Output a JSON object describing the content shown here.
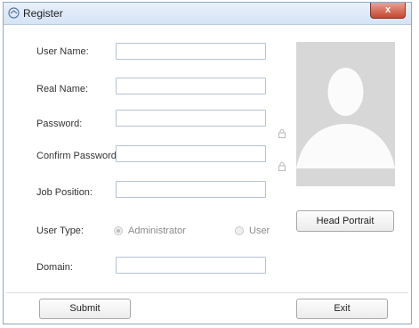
{
  "window": {
    "title": "Register",
    "close_label": "x",
    "title_icon": "register-icon"
  },
  "form": {
    "user_name": {
      "label": "User Name:",
      "value": ""
    },
    "real_name": {
      "label": "Real Name:",
      "value": ""
    },
    "password": {
      "label": "Password:",
      "value": ""
    },
    "confirm_password": {
      "label": "Confirm Password:",
      "value": ""
    },
    "job_position": {
      "label": "Job Position:",
      "value": ""
    },
    "user_type": {
      "label": "User Type:",
      "options": [
        "Administrator",
        "User"
      ],
      "selected": "Administrator"
    },
    "domain": {
      "label": "Domain:",
      "value": ""
    }
  },
  "portrait": {
    "button_label": "Head Portrait",
    "placeholder_icon": "person-silhouette-icon"
  },
  "buttons": {
    "submit": "Submit",
    "exit": "Exit"
  }
}
